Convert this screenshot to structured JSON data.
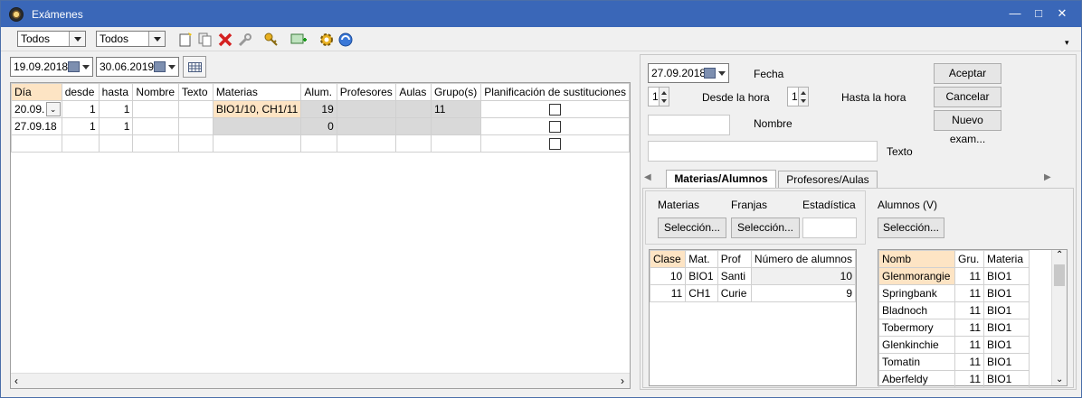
{
  "window": {
    "title": "Exámenes"
  },
  "toolbar": {
    "filter1": "Todos",
    "filter2": "Todos"
  },
  "left": {
    "date_from": "19.09.2018",
    "date_to": "30.06.2019",
    "columns": [
      "Día",
      "desde",
      "hasta",
      "Nombre",
      "Texto",
      "Materias",
      "Alum.",
      "Profesores",
      "Aulas",
      "Grupo(s)",
      "Planificación de sustituciones"
    ],
    "rows": [
      {
        "dia": "20.09.",
        "desde": "1",
        "hasta": "1",
        "nombre": "",
        "texto": "",
        "materias": "BIO1/10, CH1/11",
        "alum": "19",
        "profesores": "",
        "aulas": "",
        "grupos": "11"
      },
      {
        "dia": "27.09.18",
        "desde": "1",
        "hasta": "1",
        "nombre": "",
        "texto": "",
        "materias": "",
        "alum": "0",
        "profesores": "",
        "aulas": "",
        "grupos": ""
      }
    ]
  },
  "right": {
    "fecha_value": "27.09.2018",
    "fecha_label": "Fecha",
    "desde_value": "1",
    "desde_label": "Desde la hora",
    "hasta_value": "1",
    "hasta_label": "Hasta la hora",
    "nombre_label": "Nombre",
    "texto_label": "Texto",
    "accept": "Aceptar",
    "cancel": "Cancelar",
    "new_exam": "Nuevo exam...",
    "tabs": [
      "Materias/Alumnos",
      "Profesores/Aulas"
    ],
    "materias_label": "Materias",
    "franjas_label": "Franjas",
    "estadistica_label": "Estadística",
    "alumnos_label": "Alumnos (V)",
    "seleccion": "Selección...",
    "clase_columns": [
      "Clase",
      "Mat.",
      "Prof",
      "Número de alumnos"
    ],
    "clase_rows": [
      {
        "clase": "10",
        "mat": "BIO1",
        "prof": "Santi",
        "num": "10"
      },
      {
        "clase": "11",
        "mat": "CH1",
        "prof": "Curie",
        "num": "9"
      }
    ],
    "alumnos_columns": [
      "Nomb",
      "Gru.",
      "Materia"
    ],
    "alumnos_rows": [
      {
        "nomb": "Glenmorangie",
        "gru": "11",
        "materia": "BIO1"
      },
      {
        "nomb": "Springbank",
        "gru": "11",
        "materia": "BIO1"
      },
      {
        "nomb": "Bladnoch",
        "gru": "11",
        "materia": "BIO1"
      },
      {
        "nomb": "Tobermory",
        "gru": "11",
        "materia": "BIO1"
      },
      {
        "nomb": "Glenkinchie",
        "gru": "11",
        "materia": "BIO1"
      },
      {
        "nomb": "Tomatin",
        "gru": "11",
        "materia": "BIO1"
      },
      {
        "nomb": "Aberfeldy",
        "gru": "11",
        "materia": "BIO1"
      }
    ]
  },
  "colors": {
    "titlebar": "#3a67b8",
    "highlight": "#fde4c4",
    "readonly": "#d9d9d9"
  }
}
